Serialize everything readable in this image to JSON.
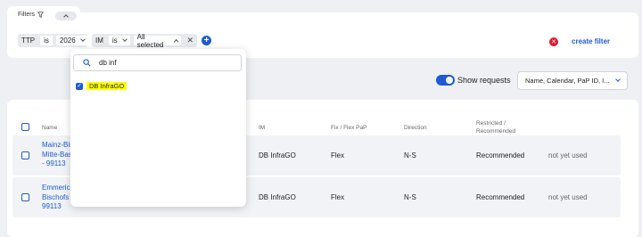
{
  "filters": {
    "label": "Filters",
    "chips": [
      {
        "field": "TTP",
        "op": "is",
        "value": "2026"
      },
      {
        "field": "IM",
        "op": "is",
        "value": "All selected"
      }
    ],
    "create_label": "create filter"
  },
  "dropdown": {
    "search_value": "db inf",
    "options": [
      {
        "label": "DB InfraGO",
        "checked": true
      }
    ]
  },
  "toolbar": {
    "show_requests_label": "Show requests",
    "show_requests_on": true,
    "columns_select": "Name, Calendar, PaP ID, I..."
  },
  "table": {
    "headers": [
      "Name",
      "IM",
      "Fix / Flex PaP",
      "Direction",
      "Restricted / Recommended"
    ],
    "rows": [
      {
        "name": "Mainz-Bis... Mitte-Bas... - 99113",
        "name_lines": [
          "Mainz-Bis",
          "Mitte-Bas",
          "- 99113"
        ],
        "im": "DB InfraGO",
        "pap": "Flex",
        "direction": "N-S",
        "restricted": "Recommended",
        "status": "not yet used"
      },
      {
        "name": "Emmerich... Bischofs... 99113",
        "name_lines": [
          "Emmerich",
          "Bischofs",
          "99113"
        ],
        "im": "DB InfraGO",
        "pap": "Flex",
        "direction": "N-S",
        "restricted": "Recommended",
        "status": "not yet used"
      }
    ]
  },
  "colors": {
    "accent": "#1d5bd6",
    "danger": "#e01b2e",
    "highlight": "#ffff00"
  }
}
